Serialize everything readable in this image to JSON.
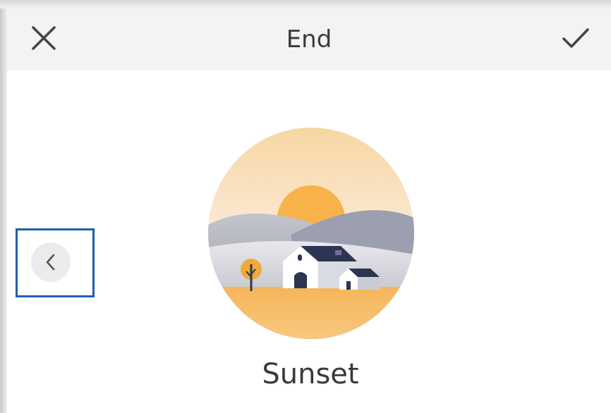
{
  "header": {
    "title": "End",
    "close_icon": "close-icon",
    "confirm_icon": "check-icon"
  },
  "carousel": {
    "prev_icon": "chevron-left-icon",
    "current_item": {
      "label": "Sunset",
      "image": "sunset-house-illustration"
    }
  },
  "colors": {
    "header_bg": "#f3f3f3",
    "text": "#3a3a3a",
    "sun": "#f7b24a",
    "highlight_border": "#1e5fae"
  }
}
